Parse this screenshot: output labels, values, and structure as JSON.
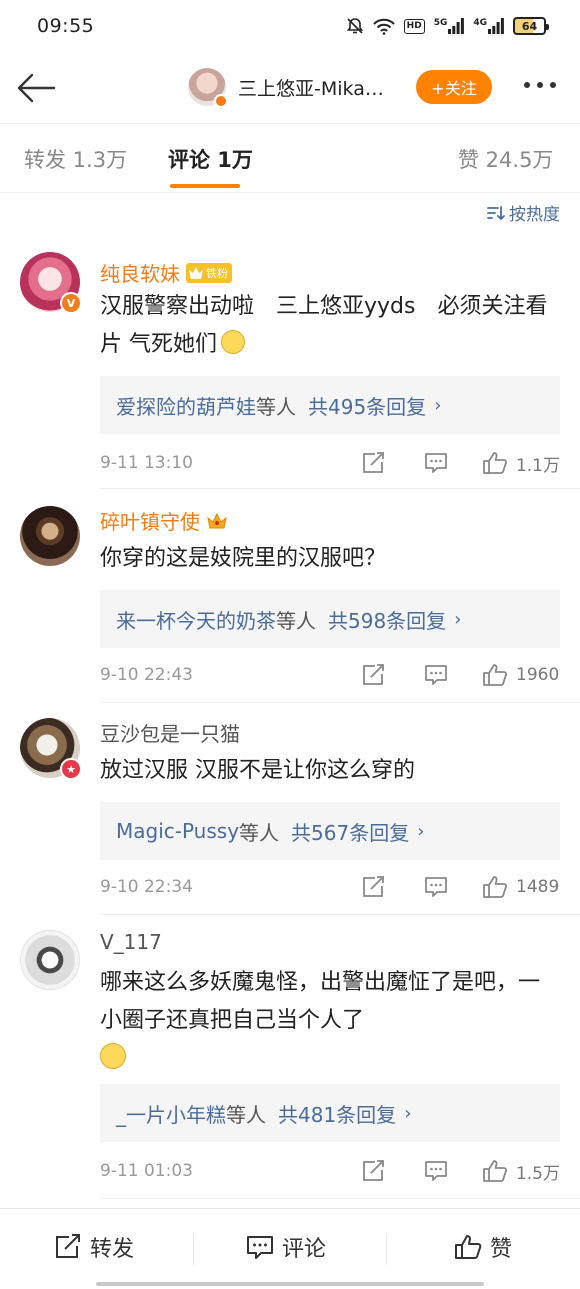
{
  "status_bar": {
    "time": "09:55",
    "hd_label": "HD",
    "net_5g": "5G",
    "net_4g": "4G",
    "battery": "64"
  },
  "header": {
    "author_name": "三上悠亚-Mika…",
    "follow_label": "+关注"
  },
  "tabs": {
    "repost": "转发 1.3万",
    "comment": "评论 1万",
    "like": "赞 24.5万"
  },
  "sort_label": "按热度",
  "comments": [
    {
      "user": "纯良软妹",
      "fan_badge": "铁粉",
      "text": "汉服警察出动啦　三上悠亚yyds　必须关注看片 气死她们",
      "reply_users": "爱探险的葫芦娃",
      "reply_suffix": "等人",
      "reply_count": "共495条回复",
      "time": "9-11 13:10",
      "likes": "1.1万"
    },
    {
      "user": "碎叶镇守使",
      "text": "你穿的这是妓院里的汉服吧？",
      "reply_users": "来一杯今天的奶茶",
      "reply_suffix": "等人",
      "reply_count": "共598条回复",
      "time": "9-10 22:43",
      "likes": "1960"
    },
    {
      "user": "豆沙包是一只猫",
      "text": "放过汉服 汉服不是让你这么穿的",
      "reply_users": "Magic-Pussy",
      "reply_suffix": "等人",
      "reply_count": "共567条回复",
      "time": "9-10 22:34",
      "likes": "1489"
    },
    {
      "user": "V_117",
      "text": "哪来这么多妖魔鬼怪，出警出魔怔了是吧，一小圈子还真把自己当个人了",
      "reply_users": "_一片小年糕",
      "reply_suffix": "等人",
      "reply_count": "共481条回复",
      "time": "9-11 01:03",
      "likes": "1.5万"
    }
  ],
  "bottom_bar": {
    "repost": "转发",
    "comment": "评论",
    "like": "赞"
  },
  "colors": {
    "accent": "#ff8200",
    "link": "#4a6c9b",
    "vip_name": "#f37d1a"
  }
}
